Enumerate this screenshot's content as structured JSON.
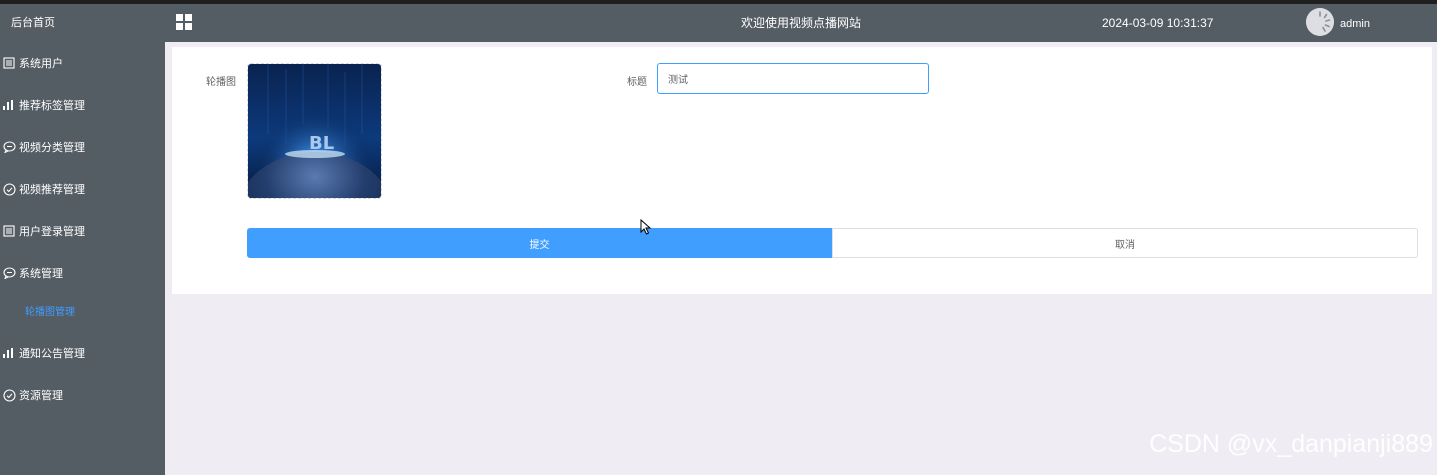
{
  "header": {
    "welcome": "欢迎使用视频点播网站",
    "datetime": "2024-03-09 10:31:37",
    "username": "admin"
  },
  "sidebar": {
    "home": "后台首页",
    "items": [
      {
        "label": "系统用户",
        "icon": "list-icon"
      },
      {
        "label": "推荐标签管理",
        "icon": "bar-chart-icon"
      },
      {
        "label": "视频分类管理",
        "icon": "chat-icon"
      },
      {
        "label": "视频推荐管理",
        "icon": "check-circle-icon"
      },
      {
        "label": "用户登录管理",
        "icon": "list-icon"
      },
      {
        "label": "系统管理",
        "icon": "chat-icon"
      },
      {
        "label": "通知公告管理",
        "icon": "bar-chart-icon"
      },
      {
        "label": "资源管理",
        "icon": "check-circle-icon"
      }
    ],
    "active_sub": "轮播图管理"
  },
  "form": {
    "image_label": "轮播图",
    "title_label": "标题",
    "title_value": "测试",
    "image_text": "BL",
    "submit_label": "提交",
    "cancel_label": "取消"
  },
  "watermark": "CSDN @vx_danpianji889",
  "colors": {
    "sidebar_bg": "#545c64",
    "primary": "#409eff",
    "page_bg": "#efedf3"
  }
}
